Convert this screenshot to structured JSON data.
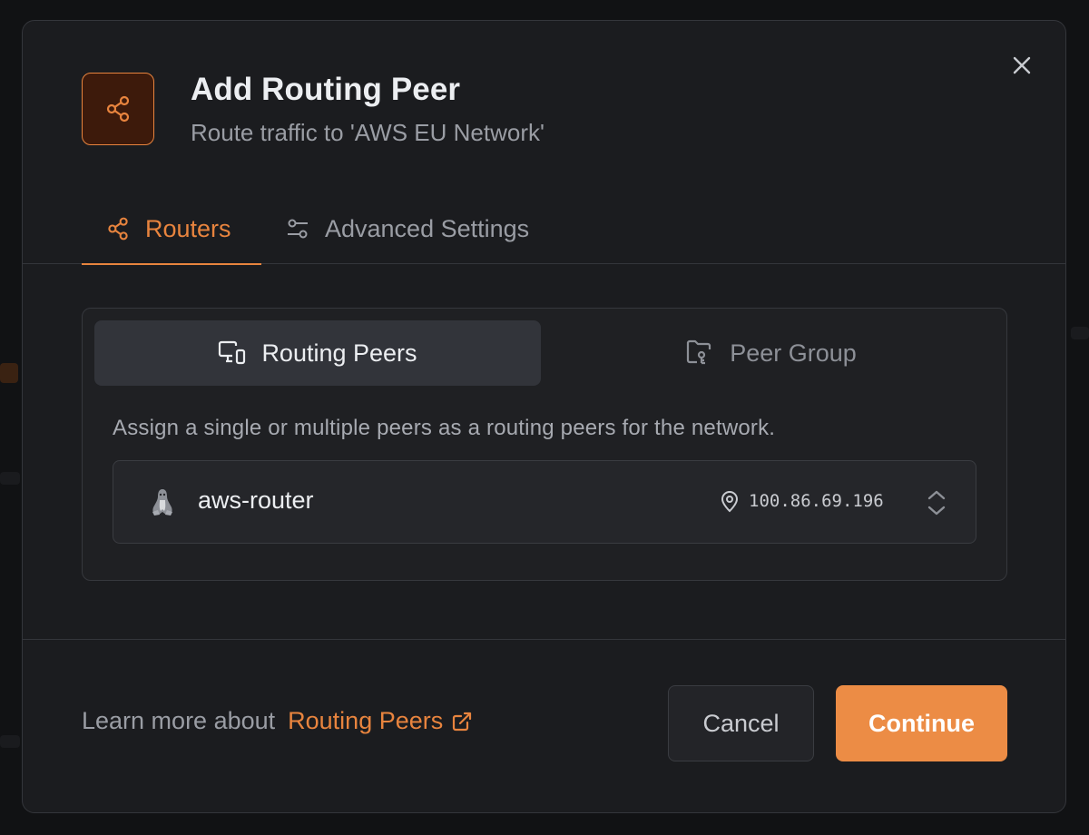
{
  "modal": {
    "title": "Add Routing Peer",
    "subtitle": "Route traffic to 'AWS EU Network'",
    "close_icon": "close-icon",
    "header_icon": "share-icon"
  },
  "tabs": [
    {
      "label": "Routers",
      "icon": "share-icon",
      "active": true
    },
    {
      "label": "Advanced Settings",
      "icon": "sliders-icon",
      "active": false
    }
  ],
  "segment": [
    {
      "label": "Routing Peers",
      "icon": "devices-icon",
      "active": true
    },
    {
      "label": "Peer Group",
      "icon": "folder-group-icon",
      "active": false
    }
  ],
  "panel": {
    "description": "Assign a single or multiple peers as a routing peers for the network."
  },
  "peer": {
    "name": "aws-router",
    "ip": "100.86.69.196",
    "os_icon": "linux-icon",
    "location_icon": "map-pin-icon",
    "chevron_icon": "chevron-up-down-icon"
  },
  "footer": {
    "learn_prefix": "Learn more about",
    "learn_link": "Routing Peers",
    "cancel_label": "Cancel",
    "continue_label": "Continue"
  },
  "colors": {
    "accent": "#e8843e",
    "button_primary": "#ec8c45",
    "modal_bg": "#1b1c1f"
  }
}
